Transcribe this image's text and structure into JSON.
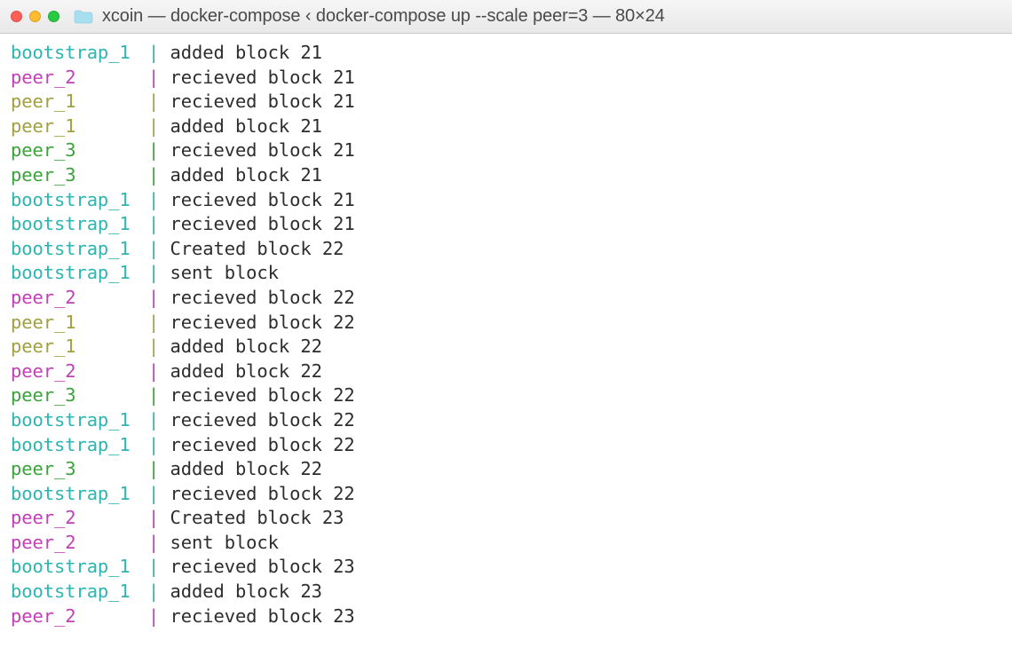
{
  "window": {
    "title": "xcoin — docker-compose ‹ docker-compose up --scale peer=3 — 80×24"
  },
  "colors": {
    "cyan": "#2fb5b0",
    "magenta": "#c33fb6",
    "olive": "#a0a040",
    "green": "#3aa33a"
  },
  "log_lines": [
    {
      "prefix": "bootstrap_1",
      "color": "cyan",
      "pipe": "|",
      "msg": " added block 21"
    },
    {
      "prefix": "peer_2",
      "color": "magenta",
      "pipe": "|",
      "msg": " recieved block 21"
    },
    {
      "prefix": "peer_1",
      "color": "olive",
      "pipe": "|",
      "msg": " recieved block 21"
    },
    {
      "prefix": "peer_1",
      "color": "olive",
      "pipe": "|",
      "msg": " added block 21"
    },
    {
      "prefix": "peer_3",
      "color": "green",
      "pipe": "|",
      "msg": " recieved block 21"
    },
    {
      "prefix": "peer_3",
      "color": "green",
      "pipe": "|",
      "msg": " added block 21"
    },
    {
      "prefix": "bootstrap_1",
      "color": "cyan",
      "pipe": "|",
      "msg": " recieved block 21"
    },
    {
      "prefix": "bootstrap_1",
      "color": "cyan",
      "pipe": "|",
      "msg": " recieved block 21"
    },
    {
      "prefix": "bootstrap_1",
      "color": "cyan",
      "pipe": "|",
      "msg": " Created block 22"
    },
    {
      "prefix": "bootstrap_1",
      "color": "cyan",
      "pipe": "|",
      "msg": " sent block"
    },
    {
      "prefix": "peer_2",
      "color": "magenta",
      "pipe": "|",
      "msg": " recieved block 22"
    },
    {
      "prefix": "peer_1",
      "color": "olive",
      "pipe": "|",
      "msg": " recieved block 22"
    },
    {
      "prefix": "peer_1",
      "color": "olive",
      "pipe": "|",
      "msg": " added block 22"
    },
    {
      "prefix": "peer_2",
      "color": "magenta",
      "pipe": "|",
      "msg": " added block 22"
    },
    {
      "prefix": "peer_3",
      "color": "green",
      "pipe": "|",
      "msg": " recieved block 22"
    },
    {
      "prefix": "bootstrap_1",
      "color": "cyan",
      "pipe": "|",
      "msg": " recieved block 22"
    },
    {
      "prefix": "bootstrap_1",
      "color": "cyan",
      "pipe": "|",
      "msg": " recieved block 22"
    },
    {
      "prefix": "peer_3",
      "color": "green",
      "pipe": "|",
      "msg": " added block 22"
    },
    {
      "prefix": "bootstrap_1",
      "color": "cyan",
      "pipe": "|",
      "msg": " recieved block 22"
    },
    {
      "prefix": "peer_2",
      "color": "magenta",
      "pipe": "|",
      "msg": " Created block 23"
    },
    {
      "prefix": "peer_2",
      "color": "magenta",
      "pipe": "|",
      "msg": " sent block"
    },
    {
      "prefix": "bootstrap_1",
      "color": "cyan",
      "pipe": "|",
      "msg": " recieved block 23"
    },
    {
      "prefix": "bootstrap_1",
      "color": "cyan",
      "pipe": "|",
      "msg": " added block 23"
    },
    {
      "prefix": "peer_2",
      "color": "magenta",
      "pipe": "|",
      "msg": " recieved block 23"
    }
  ]
}
